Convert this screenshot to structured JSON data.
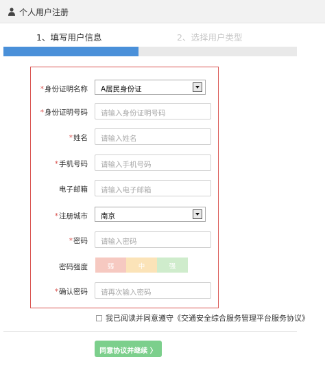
{
  "header": {
    "title": "个人用户注册",
    "icon": "user-icon"
  },
  "steps": [
    {
      "label": "1、填写用户信息",
      "active": true
    },
    {
      "label": "2、选择用户类型",
      "active": false
    }
  ],
  "progress": {
    "fraction": 0.46,
    "color": "#4a90d9"
  },
  "form": {
    "id_type": {
      "label": "身份证明名称",
      "required": true,
      "value": "A居民身份证"
    },
    "id_number": {
      "label": "身份证明号码",
      "required": true,
      "placeholder": "请输入身份证明号码"
    },
    "name": {
      "label": "姓名",
      "required": true,
      "placeholder": "请输入姓名"
    },
    "phone": {
      "label": "手机号码",
      "required": true,
      "placeholder": "请输入手机号码"
    },
    "email": {
      "label": "电子邮箱",
      "required": false,
      "placeholder": "请输入电子邮箱"
    },
    "city": {
      "label": "注册城市",
      "required": true,
      "value": "南京"
    },
    "password": {
      "label": "密码",
      "required": true,
      "placeholder": "请输入密码"
    },
    "strength": {
      "label": "密码强度",
      "levels": [
        {
          "text": "弱",
          "color": "#f6c9c1"
        },
        {
          "text": "中",
          "color": "#fbe3b8"
        },
        {
          "text": "强",
          "color": "#cfeccc"
        }
      ]
    },
    "confirm_password": {
      "label": "确认密码",
      "required": true,
      "placeholder": "请再次输入密码"
    }
  },
  "agreement": {
    "prefix": "我已阅读并同意遵守",
    "link": "《交通安全综合服务管理平台服务协议》"
  },
  "submit_label": "同意协议并继续 〉",
  "colors": {
    "accent": "#4a90d9",
    "required": "#d9534f",
    "submit": "#7ccf8c"
  }
}
